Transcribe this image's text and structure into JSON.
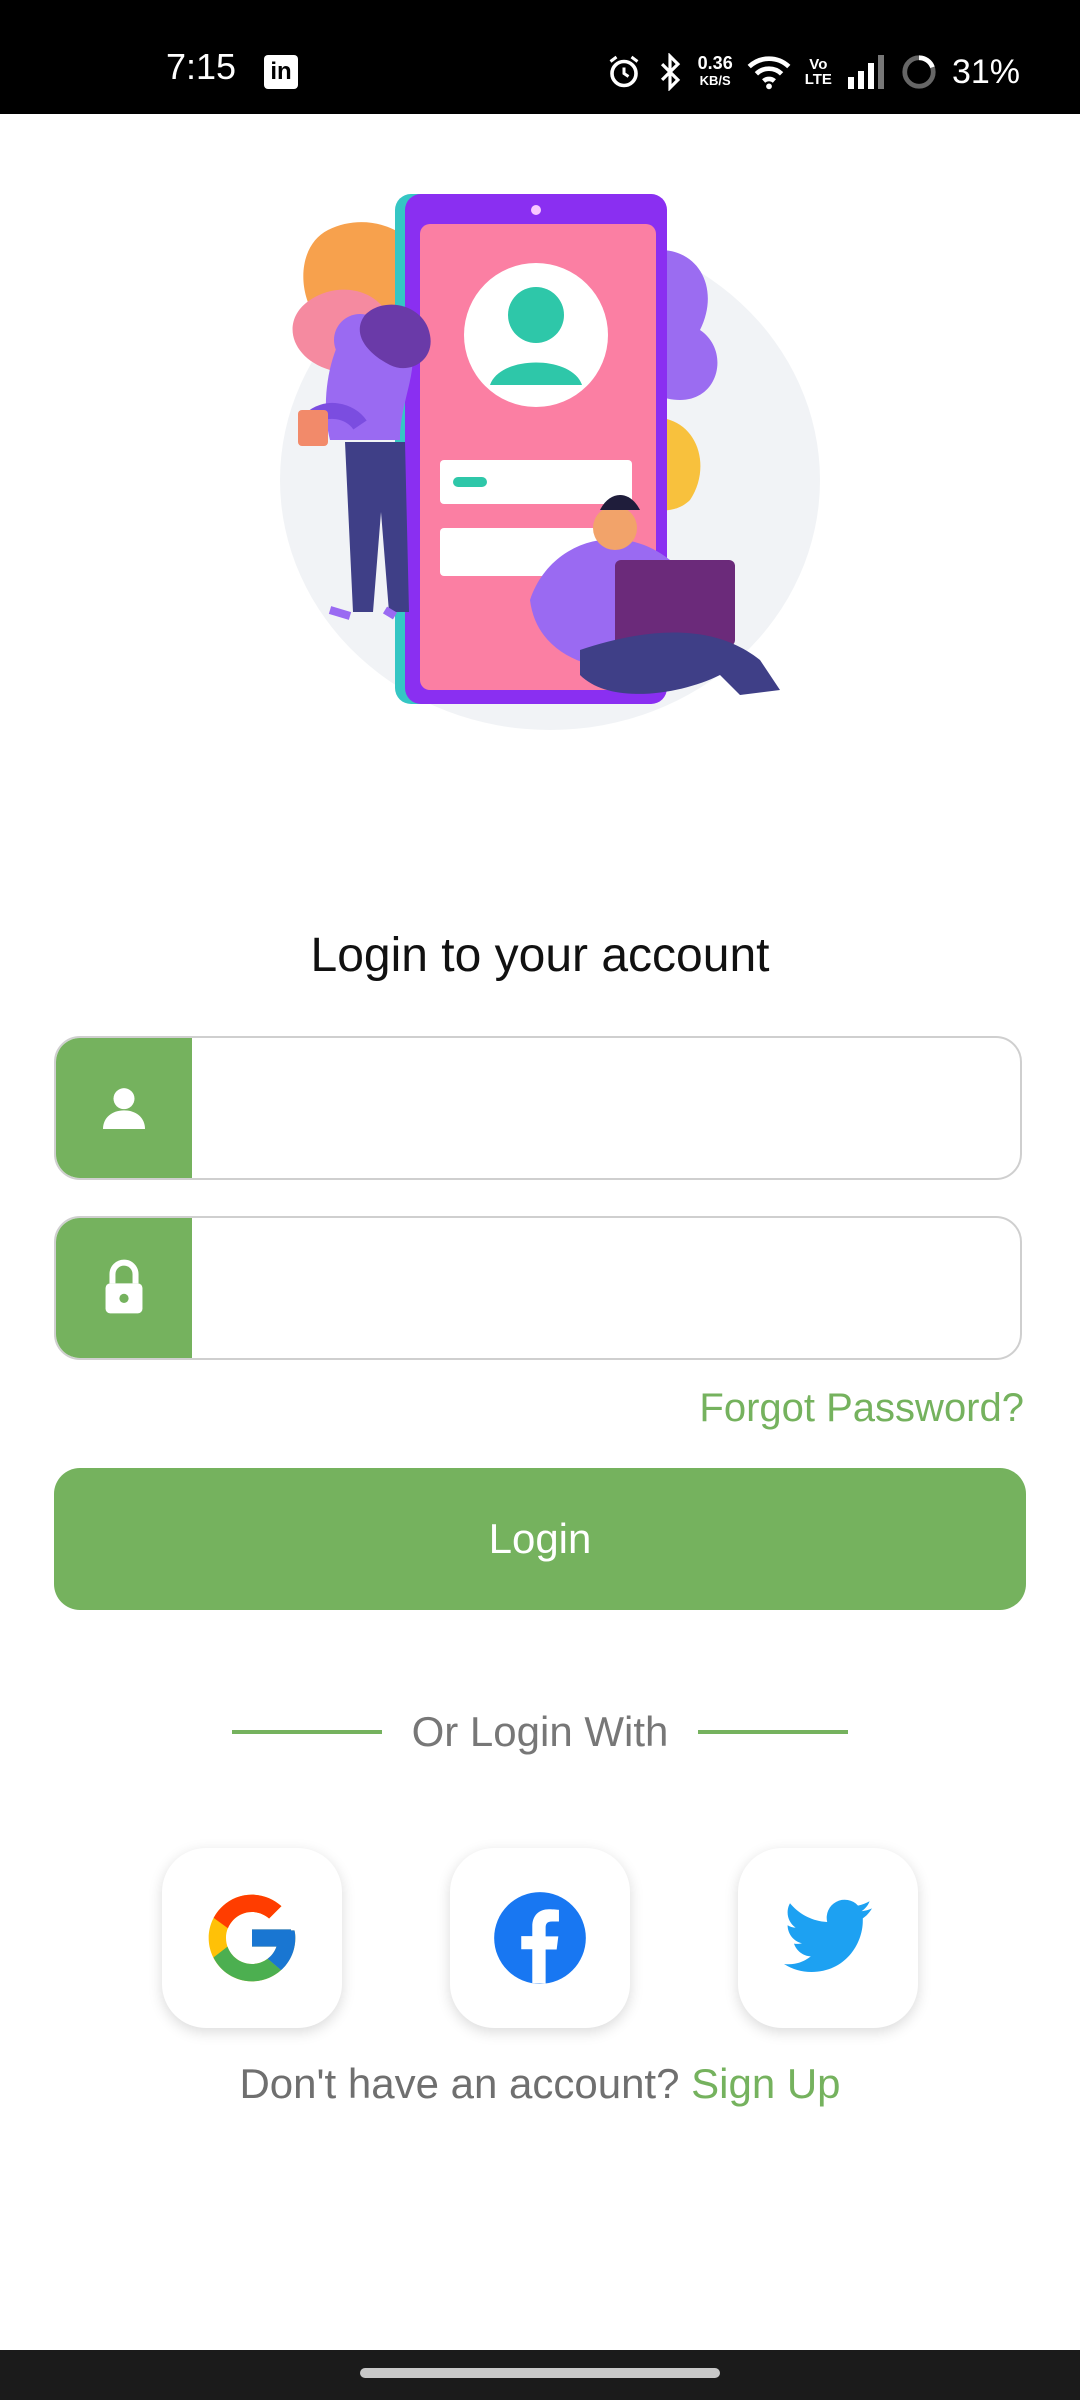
{
  "status_bar": {
    "time": "7:15",
    "linkedin_label": "in",
    "net_speed_value": "0.36",
    "net_speed_unit": "KB/S",
    "volte_top": "Vo",
    "volte_bottom": "LTE",
    "battery": "31%",
    "icons": [
      "linkedin-icon",
      "alarm-icon",
      "bluetooth-icon",
      "wifi-icon",
      "signal-icon",
      "battery-icon"
    ]
  },
  "title": "Login to your account",
  "fields": {
    "username_value": "",
    "password_value": ""
  },
  "forgot_password": "Forgot Password?",
  "login_button": "Login",
  "divider_text": "Or Login With",
  "social": [
    "google",
    "facebook",
    "twitter"
  ],
  "signup_prompt": "Don't have an account?",
  "signup_link": "Sign Up",
  "colors": {
    "accent": "#75b25e",
    "google_red": "#EA4335",
    "google_blue": "#4285F4",
    "google_yellow": "#FBBC05",
    "google_green": "#34A853",
    "facebook": "#1877F2",
    "twitter": "#1DA1F2"
  }
}
